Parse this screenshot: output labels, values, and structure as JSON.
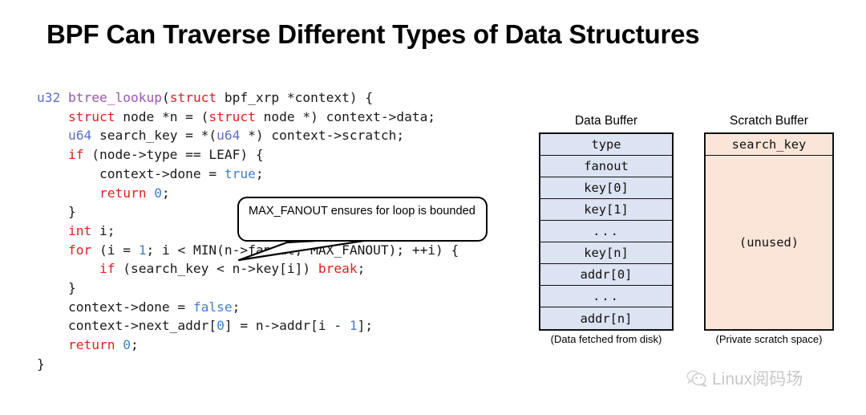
{
  "slide": {
    "title": "BPF Can Traverse Different Types of Data Structures"
  },
  "code": {
    "language": "c",
    "lines": [
      [
        {
          "t": "u32",
          "c": "type"
        },
        {
          "t": " ",
          "c": "plain"
        },
        {
          "t": "btree_lookup",
          "c": "fn"
        },
        {
          "t": "(",
          "c": "plain"
        },
        {
          "t": "struct",
          "c": "kw"
        },
        {
          "t": " bpf_xrp *context) {",
          "c": "plain"
        }
      ],
      [
        {
          "t": "    ",
          "c": "plain"
        },
        {
          "t": "struct",
          "c": "kw"
        },
        {
          "t": " node *n = (",
          "c": "plain"
        },
        {
          "t": "struct",
          "c": "kw"
        },
        {
          "t": " node *) context->data;",
          "c": "plain"
        }
      ],
      [
        {
          "t": "    ",
          "c": "plain"
        },
        {
          "t": "u64",
          "c": "type"
        },
        {
          "t": " search_key = *(",
          "c": "plain"
        },
        {
          "t": "u64",
          "c": "type"
        },
        {
          "t": " *) context->scratch;",
          "c": "plain"
        }
      ],
      [
        {
          "t": "    ",
          "c": "plain"
        },
        {
          "t": "if",
          "c": "kw"
        },
        {
          "t": " (node->type == LEAF) {",
          "c": "plain"
        }
      ],
      [
        {
          "t": "        context->done = ",
          "c": "plain"
        },
        {
          "t": "true",
          "c": "num"
        },
        {
          "t": ";",
          "c": "plain"
        }
      ],
      [
        {
          "t": "        ",
          "c": "plain"
        },
        {
          "t": "return",
          "c": "kw"
        },
        {
          "t": " ",
          "c": "plain"
        },
        {
          "t": "0",
          "c": "num"
        },
        {
          "t": ";",
          "c": "plain"
        }
      ],
      [
        {
          "t": "    }",
          "c": "plain"
        }
      ],
      [
        {
          "t": "    ",
          "c": "plain"
        },
        {
          "t": "int",
          "c": "kw"
        },
        {
          "t": " i;",
          "c": "plain"
        }
      ],
      [
        {
          "t": "    ",
          "c": "plain"
        },
        {
          "t": "for",
          "c": "kw"
        },
        {
          "t": " (i = ",
          "c": "plain"
        },
        {
          "t": "1",
          "c": "num"
        },
        {
          "t": "; i < MIN(n->fanout, MAX_FANOUT); ++i) {",
          "c": "plain"
        }
      ],
      [
        {
          "t": "        ",
          "c": "plain"
        },
        {
          "t": "if",
          "c": "kw"
        },
        {
          "t": " (search_key < n->key[i]) ",
          "c": "plain"
        },
        {
          "t": "break",
          "c": "kw"
        },
        {
          "t": ";",
          "c": "plain"
        }
      ],
      [
        {
          "t": "    }",
          "c": "plain"
        }
      ],
      [
        {
          "t": "    context->done = ",
          "c": "plain"
        },
        {
          "t": "false",
          "c": "num"
        },
        {
          "t": ";",
          "c": "plain"
        }
      ],
      [
        {
          "t": "    context->next_addr[",
          "c": "plain"
        },
        {
          "t": "0",
          "c": "num"
        },
        {
          "t": "] = n->addr[i - ",
          "c": "plain"
        },
        {
          "t": "1",
          "c": "num"
        },
        {
          "t": "];",
          "c": "plain"
        }
      ],
      [
        {
          "t": "    ",
          "c": "plain"
        },
        {
          "t": "return",
          "c": "kw"
        },
        {
          "t": " ",
          "c": "plain"
        },
        {
          "t": "0",
          "c": "num"
        },
        {
          "t": ";",
          "c": "plain"
        }
      ],
      [
        {
          "t": "}",
          "c": "plain"
        }
      ]
    ],
    "colors": {
      "type": "#5b6fc9",
      "function": "#9a55b5",
      "keyword": "#e02020",
      "number": "#3f7fd0",
      "plain": "#1a1a1a"
    }
  },
  "callout": {
    "text": "MAX_FANOUT ensures for loop is bounded"
  },
  "data_buffer": {
    "heading": "Data Buffer",
    "caption": "(Data fetched from disk)",
    "fill_color": "#dce3f2",
    "rows": [
      "type",
      "fanout",
      "key[0]",
      "key[1]",
      "...",
      "key[n]",
      "addr[0]",
      "...",
      "addr[n]"
    ]
  },
  "scratch_buffer": {
    "heading": "Scratch Buffer",
    "caption": "(Private scratch space)",
    "fill_color": "#fae5d8",
    "key_row": "search_key",
    "unused_label": "(unused)"
  },
  "watermark": {
    "icon": "wechat-bubble-icon",
    "text": "Linux阅码场"
  }
}
